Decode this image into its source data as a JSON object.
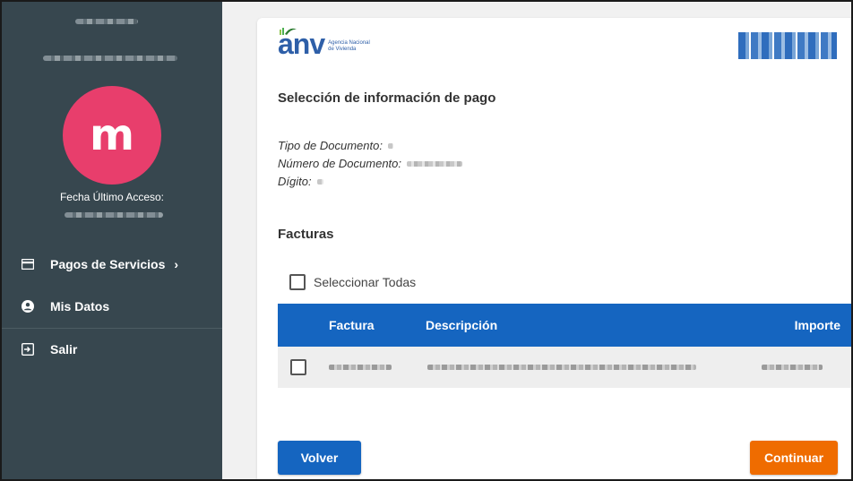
{
  "colors": {
    "sidebar_bg": "#37474f",
    "avatar_bg": "#e83e6c",
    "primary": "#1565c0",
    "accent": "#ef6c00",
    "logo_blue": "#2e5fa8"
  },
  "sidebar": {
    "avatar_letter": "m",
    "last_access_label": "Fecha Último Acceso:",
    "items": [
      {
        "label": "Pagos de Servicios",
        "icon": "credit-card-icon",
        "chevron": "›"
      },
      {
        "label": "Mis Datos",
        "icon": "account-circle-icon"
      },
      {
        "label": "Salir",
        "icon": "logout-icon"
      }
    ]
  },
  "header": {
    "logo_text": "anv",
    "logo_sub_1": "Agencia Nacional",
    "logo_sub_2": "de Vivienda"
  },
  "main": {
    "title": "Selección de información de pago",
    "fields": [
      {
        "label": "Tipo de Documento:"
      },
      {
        "label": "Número de Documento:"
      },
      {
        "label": "Dígito:"
      }
    ],
    "facturas_title": "Facturas",
    "select_all_label": "Seleccionar Todas",
    "table": {
      "columns": [
        "Factura",
        "Descripción",
        "Importe"
      ],
      "rows": [
        {
          "checked": false
        }
      ]
    },
    "buttons": {
      "back": "Volver",
      "continue": "Continuar"
    }
  }
}
